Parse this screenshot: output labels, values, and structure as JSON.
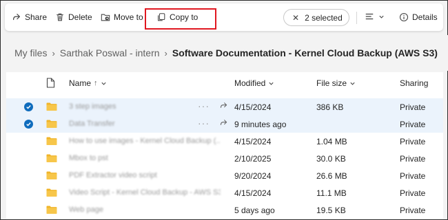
{
  "toolbar": {
    "share_label": "Share",
    "delete_label": "Delete",
    "move_label": "Move to",
    "copy_label": "Copy to",
    "selected_label": "2 selected",
    "details_label": "Details",
    "highlight_color": "#e0161f"
  },
  "breadcrumb": {
    "items": [
      "My files",
      "Sarthak Poswal - intern"
    ],
    "current": "Software Documentation - Kernel Cloud Backup (AWS S3)"
  },
  "table": {
    "headers": {
      "name": "Name",
      "name_sort": "↑",
      "modified": "Modified",
      "size": "File size",
      "sharing": "Sharing"
    },
    "rows": [
      {
        "name": "3 step images",
        "modified": "4/15/2024",
        "size": "386 KB",
        "sharing": "Private",
        "selected": true
      },
      {
        "name": "Data Transfer",
        "modified": "9 minutes ago",
        "size": "",
        "sharing": "Private",
        "selected": true
      },
      {
        "name": "How to use images - Kernel Cloud Backup (...",
        "modified": "4/15/2024",
        "size": "1.04 MB",
        "sharing": "Private",
        "selected": false
      },
      {
        "name": "Mbox to pst",
        "modified": "2/10/2025",
        "size": "30.0 KB",
        "sharing": "Private",
        "selected": false
      },
      {
        "name": "PDF Extractor video script",
        "modified": "9/20/2024",
        "size": "26.6 MB",
        "sharing": "Private",
        "selected": false
      },
      {
        "name": "Video Script - Kernel Cloud Backup - AWS S3",
        "modified": "4/15/2024",
        "size": "11.1 MB",
        "sharing": "Private",
        "selected": false
      },
      {
        "name": "Web page",
        "modified": "5 days ago",
        "size": "19.5 KB",
        "sharing": "Private",
        "selected": false
      }
    ]
  },
  "colors": {
    "accent": "#0f6cbd",
    "folder": "#f0b429",
    "selected_row": "#ebf3fc"
  }
}
